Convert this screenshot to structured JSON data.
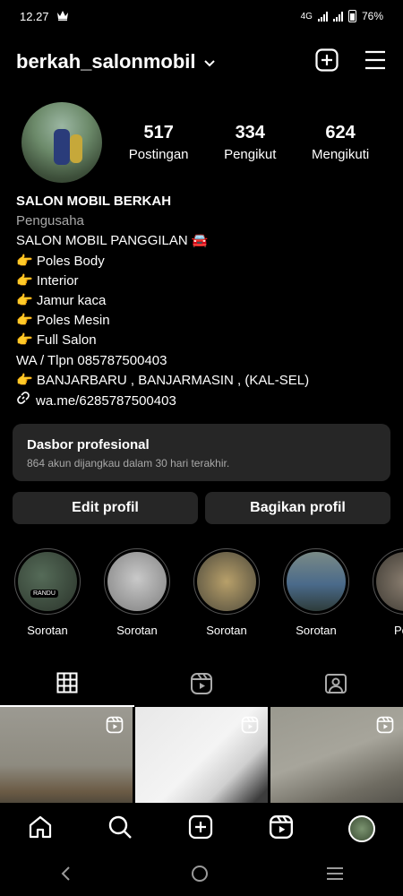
{
  "status": {
    "time": "12.27",
    "network": "4G",
    "battery": "76%"
  },
  "header": {
    "username": "berkah_salonmobil"
  },
  "stats": [
    {
      "value": "517",
      "label": "Postingan"
    },
    {
      "value": "334",
      "label": "Pengikut"
    },
    {
      "value": "624",
      "label": "Mengikuti"
    }
  ],
  "bio": {
    "name": "SALON MOBIL BERKAH",
    "category": "Pengusaha",
    "lines": [
      "SALON MOBIL PANGGILAN 🚘",
      "👉 Poles Body",
      "👉 Interior",
      "👉 Jamur kaca",
      "👉 Poles Mesin",
      "👉 Full Salon",
      "WA / Tlpn 085787500403",
      "👉 BANJARBARU , BANJARMASIN  , (KAL-SEL)"
    ],
    "link": "wa.me/6285787500403"
  },
  "dashboard": {
    "title": "Dasbor profesional",
    "subtitle": "864 akun dijangkau dalam 30 hari terakhir."
  },
  "buttons": {
    "edit": "Edit profil",
    "share": "Bagikan profil"
  },
  "highlights": [
    {
      "label": "Sorotan"
    },
    {
      "label": "Sorotan"
    },
    {
      "label": "Sorotan"
    },
    {
      "label": "Sorotan"
    },
    {
      "label": "Pole"
    }
  ],
  "highlight_badge": "RANDU",
  "icons": {
    "status": [
      "crown-icon",
      "signal-icon",
      "signal-icon",
      "battery-icon"
    ],
    "header": [
      "chevron-down-icon",
      "plus-square-icon",
      "menu-icon"
    ],
    "tabs": [
      "grid-icon",
      "reels-icon",
      "tagged-icon"
    ],
    "bottom_nav": [
      "home-icon",
      "search-icon",
      "create-icon",
      "reels-icon",
      "profile-avatar"
    ],
    "system_nav": [
      "back-icon",
      "home-circle-icon",
      "recents-icon"
    ]
  }
}
